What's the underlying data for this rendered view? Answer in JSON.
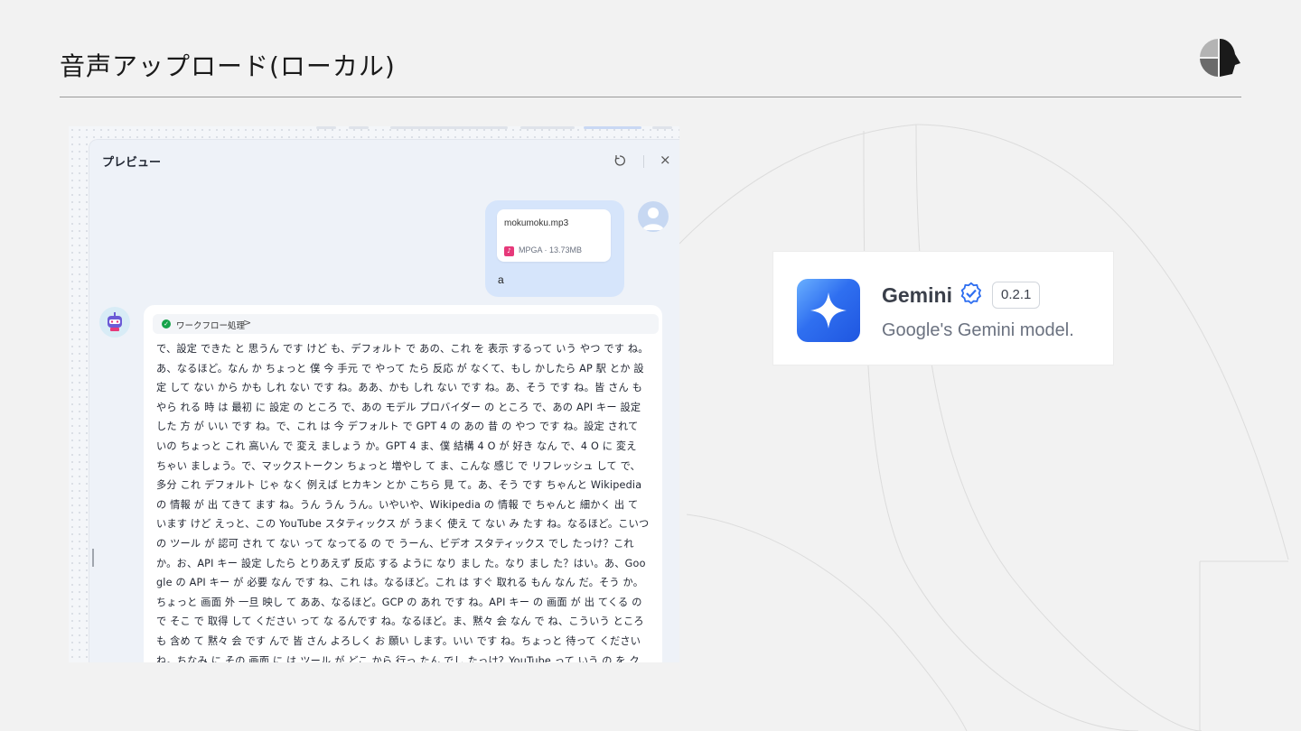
{
  "slide": {
    "title": "音声アップロード(ローカル)"
  },
  "preview": {
    "title": "プレビュー",
    "close_glyph": "×",
    "user_message": {
      "file_name": "mokumoku.mp3",
      "file_meta": "MPGA · 13.73MB",
      "text": "a"
    },
    "bot_message": {
      "workflow_label": "ワークフロー処理",
      "workflow_chevron": ">",
      "transcript": "で、設定 できた と 思うん です けど も、デフォルト で あの、これ を 表示 するって いう やつ です ね。あ、なるほど。なん か ちょっと 僕 今 手元 で やって たら 反応 が なくて、もし かしたら AP 駅 とか 設定 して ない から かも しれ ない です ね。ああ、かも しれ ない です ね。あ、そう です ね。皆 さん も やら れる 時 は 最初 に 設定 の ところ で、あの モデル プロバイダー の ところ で、あの API キー 設定 した 方 が いい です ね。で、これ は 今 デフォルト で GPT 4 の あの 昔 の やつ です ね。設定 されて いの ちょっと これ 高いん で 変え ましょう か。GPT 4 ま、僕 結構 4 O が 好き なん で、4 O に 変え ちゃい ましょう。で、マックストークン ちょっと 増やし て ま、こんな 感じ で リフレッシュ して で、多分 これ デフォルト じゃ なく 例えば ヒカキン とか こちら 見 て。あ、そう です ちゃんと Wikipedia の 情報 が 出 てきて ます ね。うん うん うん。いやいや、Wikipedia の 情報 で ちゃんと 細かく 出 て います けど えっと、この YouTube スタティックス が うまく 使え て ない み たす ね。なるほど。こいつ の ツール が 認可 され て ない って なってる の で うーん、ビデオ スタティックス でし たっけ？これ か。お、API キー 設定 したら とりあえず 反応 する ように なり まし た。なり まし た？はい。あ、Google の API キー が 必要 なん です ね、これ は。なるほど。これ は すぐ 取れる もん なん だ。そう か。ちょっと 画面 外 一旦 映し て ああ、なるほど。GCP の あれ です ね。API キー の 画面 が 出 てくる の で そこ で 取得 して ください って な るんです ね。なるほど。ま、黙々 会 なん で ね、こういう ところ も 含め て 黙々 会 です んで 皆 さん よろしく お 願い します。いい です ね。ちょっと 待って ください ね。ちなみ に その 画面 に は ツール が どこ から 行っ たん でし たっけ？YouTube って いう の を クリック する 感じ です か？あ、そう です ね。"
    }
  },
  "plugin_card": {
    "name": "Gemini",
    "version": "0.2.1",
    "description": "Google's Gemini model."
  },
  "colors": {
    "page_background": "#f2f2f2",
    "user_bubble": "#d6e5fb",
    "accent_blue": "#2f6ff0",
    "success_green": "#16a34a",
    "file_pink": "#e6397a"
  }
}
